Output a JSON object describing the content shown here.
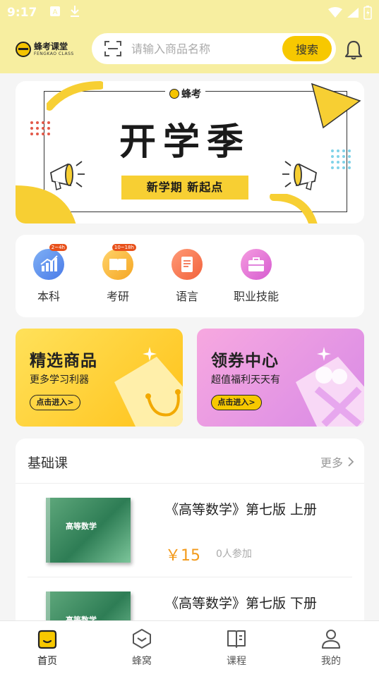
{
  "status_bar": {
    "time": "9:17"
  },
  "header": {
    "logo_cn": "蜂考课堂",
    "logo_en": "FENGKAO CLASS",
    "search_placeholder": "请输入商品名称",
    "search_button": "搜索"
  },
  "banner": {
    "logo": "蜂考",
    "title": "开学季",
    "subtitle": "新学期  新起点"
  },
  "categories": [
    {
      "label": "本科",
      "badge": "2~4h"
    },
    {
      "label": "考研",
      "badge": "10~18h"
    },
    {
      "label": "语言",
      "badge": ""
    },
    {
      "label": "职业技能",
      "badge": ""
    }
  ],
  "promos": [
    {
      "title": "精选商品",
      "subtitle": "更多学习利器",
      "button": "点击进入>"
    },
    {
      "title": "领券中心",
      "subtitle": "超值福利天天有",
      "button": "点击进入>"
    }
  ],
  "section": {
    "title": "基础课",
    "more": "更多",
    "courses": [
      {
        "name": "《高等数学》第七版 上册",
        "price": "￥15",
        "joined": "0人参加",
        "cover_text": "高等数学"
      },
      {
        "name": "《高等数学》第七版 下册",
        "price": "",
        "joined": "",
        "cover_text": "高等数学"
      }
    ]
  },
  "tabbar": [
    {
      "label": "首页"
    },
    {
      "label": "蜂窝"
    },
    {
      "label": "课程"
    },
    {
      "label": "我的"
    }
  ],
  "colors": {
    "accent": "#f7c800",
    "header_bg": "#f7eea0",
    "price": "#f39a1b"
  }
}
